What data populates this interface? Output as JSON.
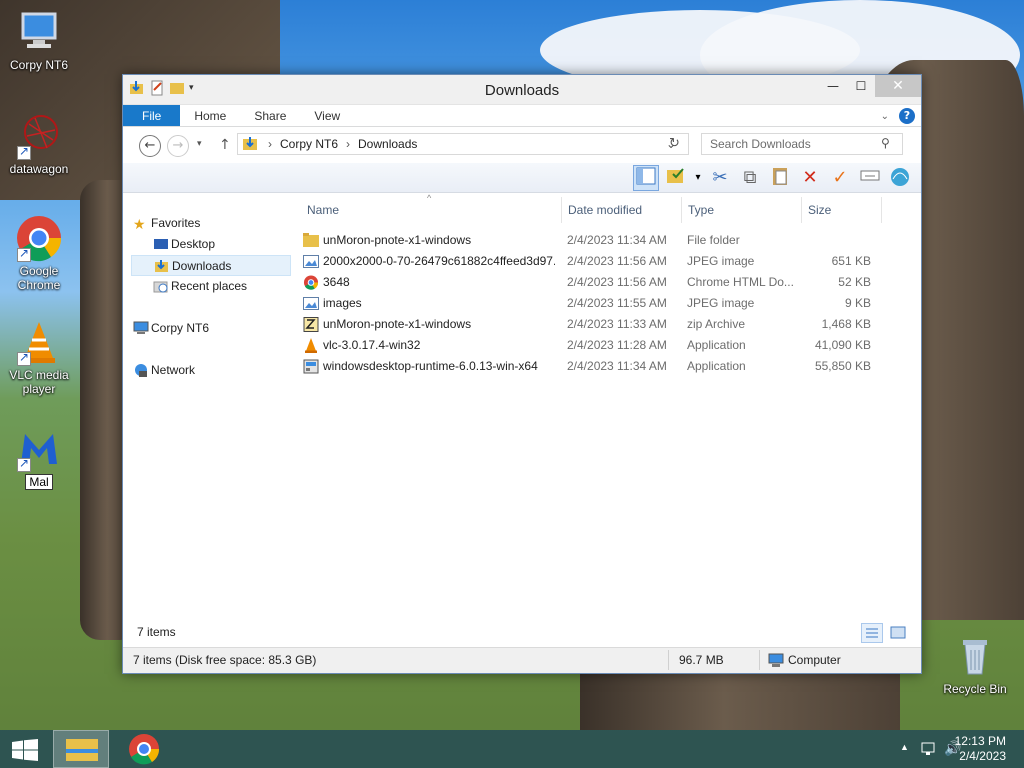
{
  "desktop": {
    "icons": [
      {
        "label": "Corpy NT6"
      },
      {
        "label": "datawagon"
      },
      {
        "label": "Google Chrome"
      },
      {
        "label": "VLC media player"
      },
      {
        "label": "Mal"
      },
      {
        "label": "Recycle Bin"
      }
    ]
  },
  "window": {
    "title": "Downloads",
    "ribbon_tabs": [
      "File",
      "Home",
      "Share",
      "View"
    ],
    "address": {
      "segments": [
        "Corpy NT6",
        "Downloads"
      ]
    },
    "search_placeholder": "Search Downloads",
    "nav": {
      "favorites": "Favorites",
      "desktop": "Desktop",
      "downloads": "Downloads",
      "recent": "Recent places",
      "computer": "Corpy NT6",
      "network": "Network"
    },
    "columns": [
      "Name",
      "Date modified",
      "Type",
      "Size"
    ],
    "files": [
      {
        "name": "unMoron-pnote-x1-windows",
        "date": "2/4/2023 11:34 AM",
        "type": "File folder",
        "size": "",
        "icon": "folder-icon"
      },
      {
        "name": "2000x2000-0-70-26479c61882c4ffeed3d97...",
        "date": "2/4/2023 11:56 AM",
        "type": "JPEG image",
        "size": "651 KB",
        "icon": "image-file-icon"
      },
      {
        "name": "3648",
        "date": "2/4/2023 11:56 AM",
        "type": "Chrome HTML Do...",
        "size": "52 KB",
        "icon": "chrome-icon"
      },
      {
        "name": "images",
        "date": "2/4/2023 11:55 AM",
        "type": "JPEG image",
        "size": "9 KB",
        "icon": "image-file-icon"
      },
      {
        "name": "unMoron-pnote-x1-windows",
        "date": "2/4/2023 11:33 AM",
        "type": "zip Archive",
        "size": "1,468 KB",
        "icon": "zip-archive-icon"
      },
      {
        "name": "vlc-3.0.17.4-win32",
        "date": "2/4/2023 11:28 AM",
        "type": "Application",
        "size": "41,090 KB",
        "icon": "vlc-icon"
      },
      {
        "name": "windowsdesktop-runtime-6.0.13-win-x64",
        "date": "2/4/2023 11:34 AM",
        "type": "Application",
        "size": "55,850 KB",
        "icon": "installer-icon"
      }
    ],
    "item_count": "7 items",
    "status": {
      "left": "7 items (Disk free space: 85.3 GB)",
      "size": "96.7 MB",
      "location": "Computer"
    }
  },
  "taskbar": {
    "time": "12:13 PM",
    "date": "2/4/2023"
  },
  "colors": {
    "accent": "#1979ca",
    "selection": "#e5f1fb"
  }
}
